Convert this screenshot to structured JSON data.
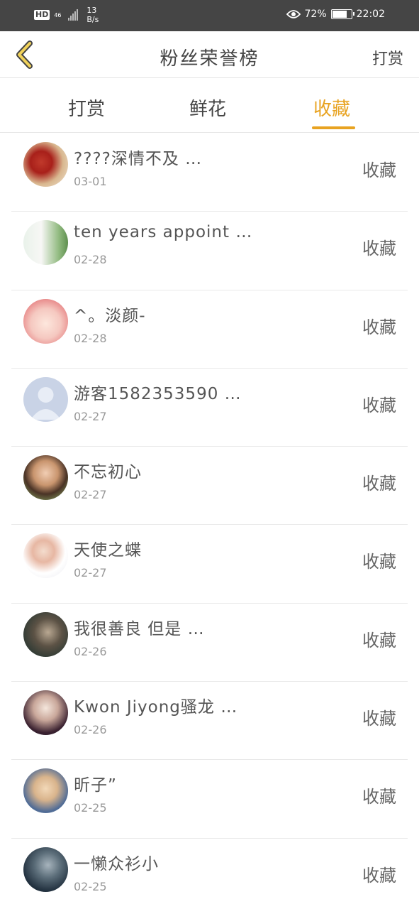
{
  "status_bar": {
    "hd": "HD",
    "network": "46",
    "speed_value": "13",
    "speed_unit": "B/s",
    "eye_icon": "eye-icon",
    "battery": "72%",
    "time": "22:02"
  },
  "header": {
    "back_icon": "chevron-left-icon",
    "title": "粉丝荣誉榜",
    "right_label": "打赏"
  },
  "tabs": [
    {
      "label": "打赏",
      "active": false
    },
    {
      "label": "鲜花",
      "active": false
    },
    {
      "label": "收藏",
      "active": true
    }
  ],
  "accent_color": "#e8a321",
  "list": [
    {
      "name": "????深情不及 …",
      "date": "03-01",
      "action": "收藏"
    },
    {
      "name": "ten years appoint …",
      "date": "02-28",
      "action": "收藏"
    },
    {
      "name": "^。淡颜-",
      "date": "02-28",
      "action": "收藏"
    },
    {
      "name": "游客1582353590 …",
      "date": "02-27",
      "action": "收藏"
    },
    {
      "name": "不忘初心",
      "date": "02-27",
      "action": "收藏"
    },
    {
      "name": "天使之蝶",
      "date": "02-27",
      "action": "收藏"
    },
    {
      "name": "我很善良 但是 …",
      "date": "02-26",
      "action": "收藏"
    },
    {
      "name": "Kwon Jiyong骚龙 …",
      "date": "02-26",
      "action": "收藏"
    },
    {
      "name": "昕子”",
      "date": "02-25",
      "action": "收藏"
    },
    {
      "name": "一懒众衫小",
      "date": "02-25",
      "action": "收藏"
    }
  ]
}
